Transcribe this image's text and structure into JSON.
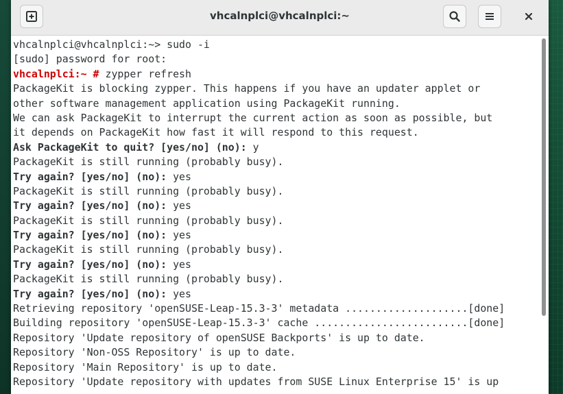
{
  "window": {
    "title": "vhcalnplci@vhcalnplci:~"
  },
  "colors": {
    "prompt_red": "#cc0000",
    "text": "#2e3436",
    "terminal_bg": "#ffffff",
    "titlebar_bg": "#ebebeb"
  },
  "icons": {
    "new_tab": "new-tab-icon",
    "search": "search-icon",
    "menu": "hamburger-menu-icon",
    "close": "close-icon"
  },
  "terminal": {
    "lines": [
      [
        {
          "t": "vhcalnplci@vhcalnplci:~> sudo -i",
          "s": ""
        }
      ],
      [
        {
          "t": "[sudo] password for root:",
          "s": ""
        }
      ],
      [
        {
          "t": "vhcalnplci:~ #",
          "s": "prompt"
        },
        {
          "t": " zypper refresh",
          "s": ""
        }
      ],
      [
        {
          "t": "PackageKit is blocking zypper. This happens if you have an updater applet or",
          "s": ""
        }
      ],
      [
        {
          "t": "other software management application using PackageKit running.",
          "s": ""
        }
      ],
      [
        {
          "t": "We can ask PackageKit to interrupt the current action as soon as possible, but",
          "s": ""
        }
      ],
      [
        {
          "t": "it depends on PackageKit how fast it will respond to this request.",
          "s": ""
        }
      ],
      [
        {
          "t": "Ask PackageKit to quit? [yes/no] (no):",
          "s": "b"
        },
        {
          "t": " y",
          "s": ""
        }
      ],
      [
        {
          "t": "PackageKit is still running (probably busy).",
          "s": ""
        }
      ],
      [
        {
          "t": "Try again? [yes/no] (no):",
          "s": "b"
        },
        {
          "t": " yes",
          "s": ""
        }
      ],
      [
        {
          "t": "PackageKit is still running (probably busy).",
          "s": ""
        }
      ],
      [
        {
          "t": "Try again? [yes/no] (no):",
          "s": "b"
        },
        {
          "t": " yes",
          "s": ""
        }
      ],
      [
        {
          "t": "PackageKit is still running (probably busy).",
          "s": ""
        }
      ],
      [
        {
          "t": "Try again? [yes/no] (no):",
          "s": "b"
        },
        {
          "t": " yes",
          "s": ""
        }
      ],
      [
        {
          "t": "PackageKit is still running (probably busy).",
          "s": ""
        }
      ],
      [
        {
          "t": "Try again? [yes/no] (no):",
          "s": "b"
        },
        {
          "t": " yes",
          "s": ""
        }
      ],
      [
        {
          "t": "PackageKit is still running (probably busy).",
          "s": ""
        }
      ],
      [
        {
          "t": "Try again? [yes/no] (no):",
          "s": "b"
        },
        {
          "t": " yes",
          "s": ""
        }
      ],
      [
        {
          "t": "Retrieving repository 'openSUSE-Leap-15.3-3' metadata ....................[done]",
          "s": ""
        }
      ],
      [
        {
          "t": "Building repository 'openSUSE-Leap-15.3-3' cache .........................[done]",
          "s": ""
        }
      ],
      [
        {
          "t": "Repository 'Update repository of openSUSE Backports' is up to date.",
          "s": ""
        }
      ],
      [
        {
          "t": "Repository 'Non-OSS Repository' is up to date.",
          "s": ""
        }
      ],
      [
        {
          "t": "Repository 'Main Repository' is up to date.",
          "s": ""
        }
      ],
      [
        {
          "t": "Repository 'Update repository with updates from SUSE Linux Enterprise 15' is up",
          "s": ""
        }
      ]
    ]
  }
}
